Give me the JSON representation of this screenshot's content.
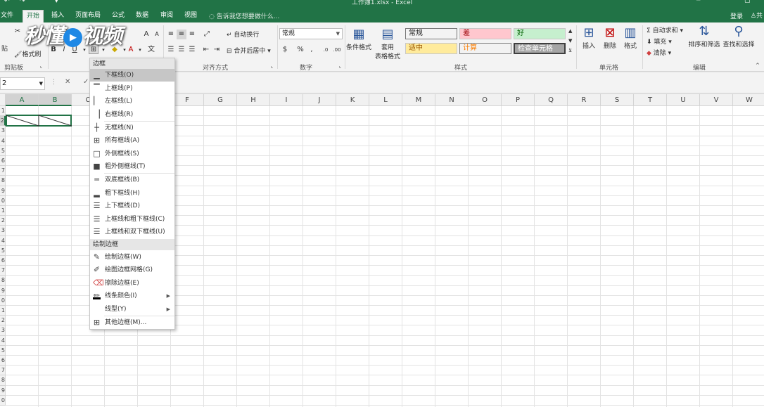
{
  "window": {
    "title": "工作簿1.xlsx - Excel",
    "quick_access": [
      "↶",
      "↷",
      "▾"
    ],
    "controls": [
      "─",
      "▢"
    ]
  },
  "tabs": [
    {
      "label": "文件"
    },
    {
      "label": "开始",
      "active": true
    },
    {
      "label": "插入"
    },
    {
      "label": "页面布局"
    },
    {
      "label": "公式"
    },
    {
      "label": "数据"
    },
    {
      "label": "审阅"
    },
    {
      "label": "视图"
    }
  ],
  "tell_me": "告诉我您想要做什么...",
  "login": "登录",
  "share": "共",
  "watermark": "秒懂视频",
  "ribbon": {
    "clipboard": {
      "paste": "贴",
      "format_painter": "格式刷",
      "label": "剪贴板"
    },
    "font": {
      "bold": "B",
      "italic": "I",
      "underline": "U",
      "font_color": "A"
    },
    "alignment": {
      "wrap_text": "自动换行",
      "merge_center": "合并后居中",
      "label": "对齐方式"
    },
    "number": {
      "format_value": "常规",
      "percent": "%",
      "comma": ",",
      "label": "数字"
    },
    "styles": {
      "conditional_format": "条件格式",
      "table_format_1": "套用",
      "table_format_2": "表格格式",
      "cells": [
        {
          "text": "常规",
          "bg": "#ffffff",
          "fg": "#000000"
        },
        {
          "text": "差",
          "bg": "#ffc7ce",
          "fg": "#9c0006"
        },
        {
          "text": "好",
          "bg": "#c6efce",
          "fg": "#006100"
        },
        {
          "text": "适中",
          "bg": "#ffeb9c",
          "fg": "#9c5700"
        },
        {
          "text": "计算",
          "bg": "#f2f2f2",
          "fg": "#fa7d00"
        },
        {
          "text": "检查单元格",
          "bg": "#a5a5a5",
          "fg": "#ffffff"
        }
      ],
      "label": "样式"
    },
    "cells_group": {
      "insert": "插入",
      "delete": "删除",
      "format": "格式",
      "label": "单元格"
    },
    "editing": {
      "autosum": "自动求和",
      "fill": "填充",
      "clear": "清除",
      "sort_filter": "排序和筛选",
      "find_select": "查找和选择",
      "label": "编辑"
    }
  },
  "formula_bar": {
    "name_box": "2",
    "fx": "✕"
  },
  "columns": [
    "A",
    "B",
    "C",
    "D",
    "E",
    "F",
    "G",
    "H",
    "I",
    "J",
    "K",
    "L",
    "M",
    "N",
    "O",
    "P",
    "Q",
    "R",
    "S",
    "T",
    "U",
    "V",
    "W"
  ],
  "rows": [
    "1",
    "2",
    "3",
    "4",
    "5",
    "6",
    "7",
    "8",
    "9",
    "0",
    "1",
    "2",
    "3",
    "4",
    "5",
    "6",
    "7",
    "8",
    "9",
    "0",
    "1",
    "2",
    "3",
    "4",
    "5",
    "6",
    "7",
    "8",
    "9",
    "0"
  ],
  "border_menu": {
    "header": "边框",
    "items": [
      {
        "label": "下框线(O)",
        "icon": "bottom-border-icon",
        "glyph": "▁",
        "highlighted": true
      },
      {
        "label": "上框线(P)",
        "icon": "top-border-icon",
        "glyph": "▔"
      },
      {
        "label": "左框线(L)",
        "icon": "left-border-icon",
        "glyph": "▏"
      },
      {
        "label": "右框线(R)",
        "icon": "right-border-icon",
        "glyph": "▕"
      },
      {
        "label": "无框线(N)",
        "icon": "no-border-icon",
        "glyph": "┼"
      },
      {
        "label": "所有框线(A)",
        "icon": "all-borders-icon",
        "glyph": "⊞"
      },
      {
        "label": "外侧框线(S)",
        "icon": "outside-borders-icon",
        "glyph": "□"
      },
      {
        "label": "粗外侧框线(T)",
        "icon": "thick-outside-borders-icon",
        "glyph": "■"
      },
      {
        "label": "双底框线(B)",
        "icon": "double-bottom-border-icon",
        "glyph": "═"
      },
      {
        "label": "粗下框线(H)",
        "icon": "thick-bottom-border-icon",
        "glyph": "▂"
      },
      {
        "label": "上下框线(D)",
        "icon": "top-bottom-border-icon",
        "glyph": "☰"
      },
      {
        "label": "上框线和粗下框线(C)",
        "icon": "top-thick-bottom-border-icon",
        "glyph": "☰"
      },
      {
        "label": "上框线和双下框线(U)",
        "icon": "top-double-bottom-border-icon",
        "glyph": "☰"
      }
    ],
    "draw_header": "绘制边框",
    "draw_items": [
      {
        "label": "绘制边框(W)",
        "icon": "draw-border-icon",
        "glyph": "✎"
      },
      {
        "label": "绘图边框网格(G)",
        "icon": "draw-border-grid-icon",
        "glyph": "✐"
      },
      {
        "label": "擦除边框(E)",
        "icon": "eraser-icon",
        "glyph": "⌫"
      },
      {
        "label": "线条颜色(I)",
        "icon": "line-color-icon",
        "glyph": "✏",
        "submenu": true
      },
      {
        "label": "线型(Y)",
        "icon": "line-style-icon",
        "glyph": "",
        "submenu": true
      },
      {
        "label": "其他边框(M)...",
        "icon": "more-borders-icon",
        "glyph": "⊞"
      }
    ]
  }
}
